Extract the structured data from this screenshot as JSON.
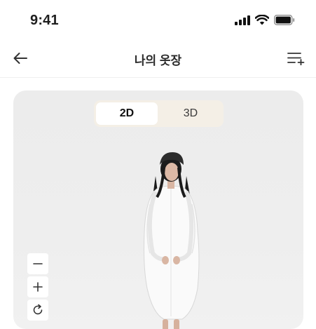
{
  "status_bar": {
    "time": "9:41",
    "icons": [
      "signal-icon",
      "wifi-icon",
      "battery-icon"
    ]
  },
  "nav": {
    "title": "나의 옷장",
    "back_icon": "arrow-left-icon",
    "menu_icon": "list-add-icon"
  },
  "viewer": {
    "modes": [
      {
        "label": "2D",
        "active": true
      },
      {
        "label": "3D",
        "active": false
      }
    ],
    "zoom_controls": [
      "minus-icon",
      "plus-icon",
      "rotate-icon"
    ]
  },
  "colors": {
    "toggle_bg": "#f4efe6",
    "card_bg": "#ececec",
    "text": "#1e1e1e"
  }
}
